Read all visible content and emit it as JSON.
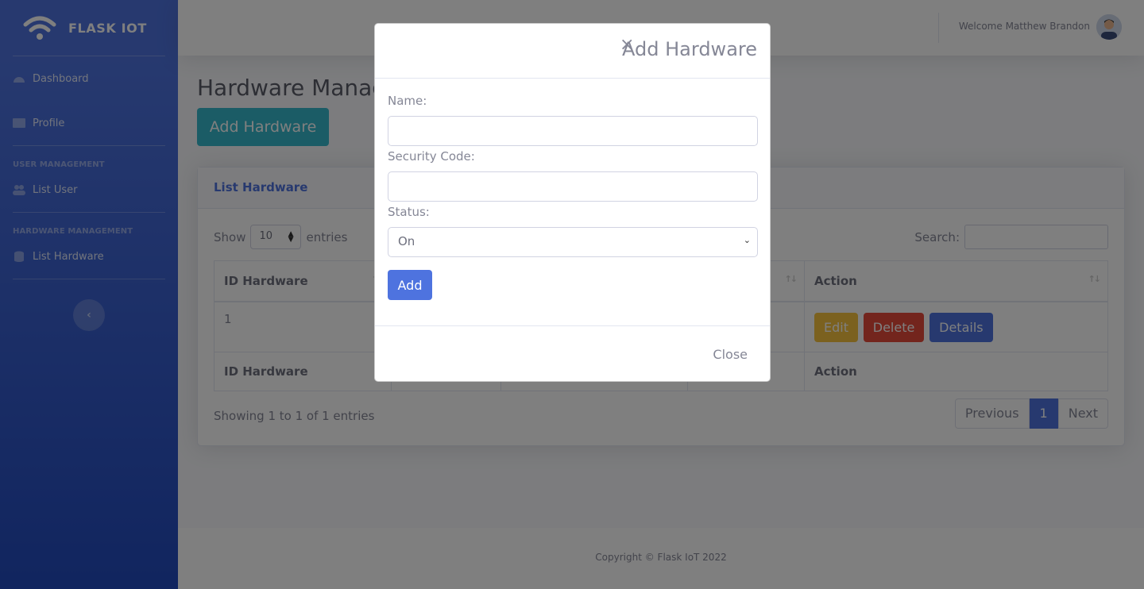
{
  "brand": {
    "name": "FLASK IOT"
  },
  "sidebar": {
    "items": [
      {
        "label": "Dashboard"
      },
      {
        "label": "Profile"
      }
    ],
    "user_heading": "USER MANAGEMENT",
    "user_items": [
      {
        "label": "List User"
      }
    ],
    "hardware_heading": "HARDWARE MANAGEMENT",
    "hardware_items": [
      {
        "label": "List Hardware"
      }
    ]
  },
  "topbar": {
    "welcome": "Welcome Matthew Brandon"
  },
  "page": {
    "title": "Hardware Management",
    "add_button": "Add Hardware"
  },
  "card": {
    "title": "List Hardware",
    "show_label": "Show",
    "entries_label": "entries",
    "page_length": "10",
    "search_label": "Search:",
    "columns": [
      "ID Hardware",
      "",
      "",
      "",
      "Action"
    ],
    "rows": [
      {
        "id": "1"
      }
    ],
    "row_actions": [
      "Edit",
      "Delete",
      "Details"
    ],
    "info": "Showing 1 to 1 of 1 entries",
    "pagination": {
      "previous": "Previous",
      "current": "1",
      "next": "Next"
    }
  },
  "footer": {
    "text": "Copyright © Flask IoT 2022"
  },
  "modal": {
    "close_x": "×",
    "title": "Add Hardware",
    "name_label": "Name:",
    "name_value": "",
    "security_label": "Security Code:",
    "security_value": "",
    "status_label": "Status:",
    "status_value": "On",
    "submit_label": "Add",
    "close_label": "Close"
  },
  "colors": {
    "primary": "#4e73df",
    "info": "#36b9cc",
    "warning": "#f6c23e",
    "danger": "#e74a3b"
  }
}
